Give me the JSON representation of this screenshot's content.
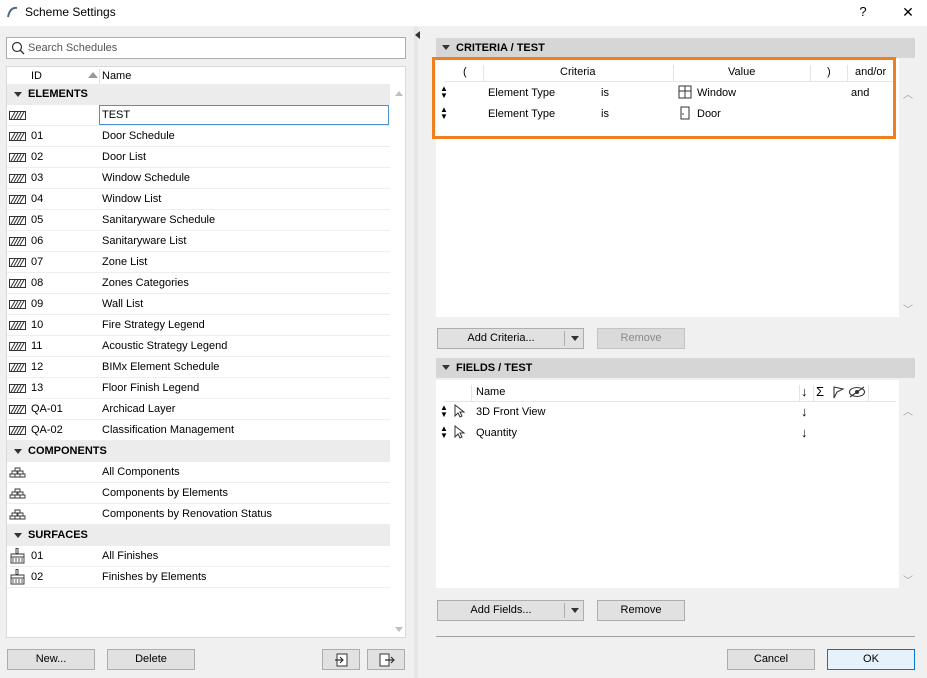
{
  "window": {
    "title": "Scheme Settings",
    "help_label": "?",
    "close_label": "✕"
  },
  "search": {
    "placeholder": "Search Schedules",
    "value": ""
  },
  "list": {
    "columns": {
      "id": "ID",
      "name": "Name"
    },
    "groups": [
      {
        "label": "ELEMENTS",
        "items": [
          {
            "id": "",
            "name": "TEST",
            "selected": true
          },
          {
            "id": "01",
            "name": "Door Schedule"
          },
          {
            "id": "02",
            "name": "Door List"
          },
          {
            "id": "03",
            "name": "Window Schedule"
          },
          {
            "id": "04",
            "name": "Window List"
          },
          {
            "id": "05",
            "name": "Sanitaryware Schedule"
          },
          {
            "id": "06",
            "name": "Sanitaryware List"
          },
          {
            "id": "07",
            "name": "Zone List"
          },
          {
            "id": "08",
            "name": "Zones Categories"
          },
          {
            "id": "09",
            "name": "Wall List"
          },
          {
            "id": "10",
            "name": "Fire Strategy Legend"
          },
          {
            "id": "11",
            "name": "Acoustic Strategy Legend"
          },
          {
            "id": "12",
            "name": "BIMx Element Schedule"
          },
          {
            "id": "13",
            "name": "Floor Finish Legend"
          },
          {
            "id": "QA-01",
            "name": "Archicad Layer"
          },
          {
            "id": "QA-02",
            "name": "Classification Management"
          }
        ]
      },
      {
        "label": "COMPONENTS",
        "items": [
          {
            "id": "",
            "name": "All Components"
          },
          {
            "id": "",
            "name": "Components by Elements"
          },
          {
            "id": "",
            "name": "Components by Renovation Status"
          }
        ]
      },
      {
        "label": "SURFACES",
        "items": [
          {
            "id": "01",
            "name": "All Finishes"
          },
          {
            "id": "02",
            "name": "Finishes by Elements"
          }
        ]
      }
    ]
  },
  "left_buttons": {
    "new": "New...",
    "delete": "Delete"
  },
  "criteria": {
    "header": "CRITERIA /  TEST",
    "columns": {
      "open": "(",
      "criteria": "Criteria",
      "value": "Value",
      "close": ")",
      "andor": "and/or"
    },
    "rows": [
      {
        "criteria": "Element Type",
        "op": "is",
        "value": "Window",
        "icon": "window-icon",
        "andor": "and"
      },
      {
        "criteria": "Element Type",
        "op": "is",
        "value": "Door",
        "icon": "door-icon",
        "andor": ""
      }
    ],
    "add_label": "Add Criteria...",
    "remove_label": "Remove"
  },
  "fields": {
    "header": "FIELDS /  TEST",
    "columns": {
      "name": "Name",
      "sort": "↓",
      "sum": "Σ",
      "flag": "flag-icon",
      "hide": "hide-icon"
    },
    "rows": [
      {
        "name": "3D Front View",
        "sort": "↓"
      },
      {
        "name": "Quantity",
        "sort": "↓"
      }
    ],
    "add_label": "Add Fields...",
    "remove_label": "Remove"
  },
  "footer": {
    "cancel": "Cancel",
    "ok": "OK"
  },
  "colors": {
    "highlight": "#f07f1e",
    "accent": "#0078d7"
  }
}
